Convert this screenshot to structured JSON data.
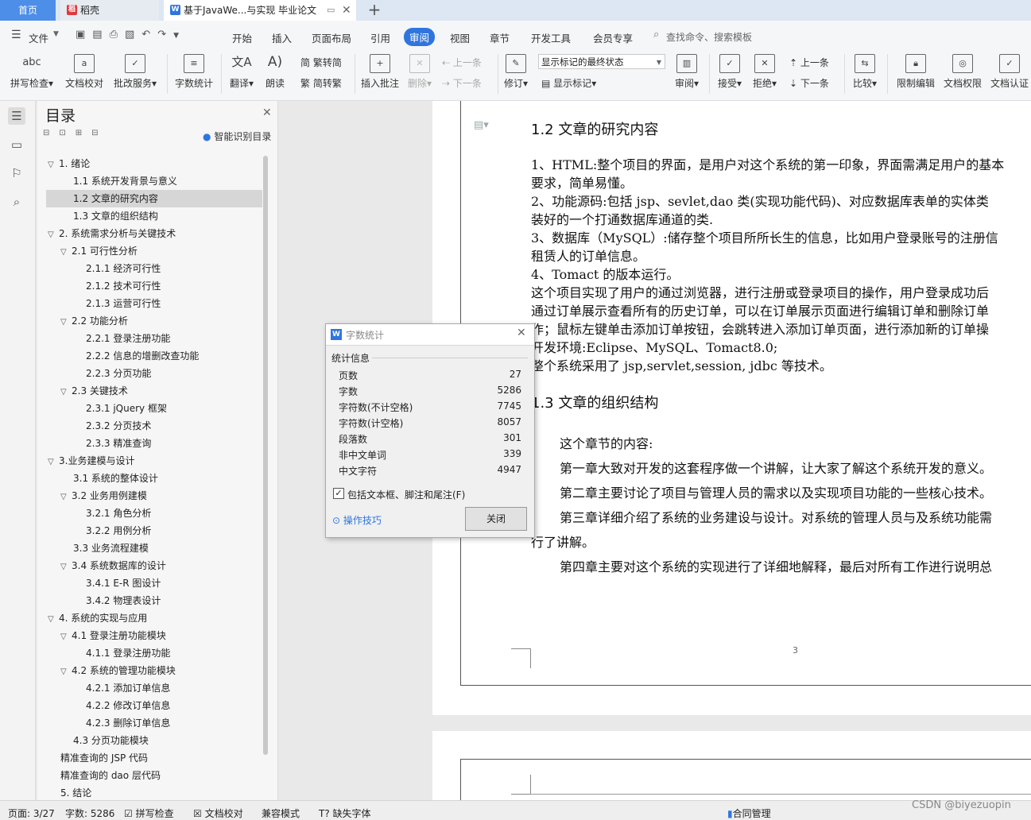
{
  "tabs": {
    "home": "首页",
    "daoke": "稻壳",
    "doc": "基于JavaWe...与实现 毕业论文"
  },
  "menu": {
    "file": "文件",
    "items": [
      "开始",
      "插入",
      "页面布局",
      "引用",
      "审阅",
      "视图",
      "章节",
      "开发工具",
      "会员专享"
    ],
    "search_placeholder": "查找命令、搜索模板"
  },
  "ribbon": {
    "spellcheck": "拼写检查",
    "proofread": "文档校对",
    "batch": "批改服务",
    "wordcount": "字数统计",
    "translate": "翻译",
    "read": "朗读",
    "trad": "繁转简",
    "simp": "简转繁",
    "insert_comment": "插入批注",
    "delete": "删除",
    "prev": "上一条",
    "next": "下一条",
    "revise": "修订",
    "combo_value": "显示标记的最终状态",
    "show_marks": "显示标记",
    "review": "审阅",
    "accept": "接受",
    "reject": "拒绝",
    "prev2": "上一条",
    "next2": "下一条",
    "compare": "比较",
    "restrict": "限制编辑",
    "perm": "文档权限",
    "auth": "文档认证"
  },
  "toc": {
    "title": "目录",
    "smart": "智能识别目录",
    "items": [
      {
        "text": "1. 绪论",
        "level": 0,
        "caret": true
      },
      {
        "text": "1.1  系统开发背景与意义",
        "level": 1,
        "caret": false
      },
      {
        "text": "1.2  文章的研究内容",
        "level": 1,
        "caret": false,
        "selected": true
      },
      {
        "text": "1.3  文章的组织结构",
        "level": 1,
        "caret": false
      },
      {
        "text": "2.  系统需求分析与关键技术",
        "level": 0,
        "caret": true
      },
      {
        "text": "2.1  可行性分析",
        "level": 1,
        "caret": true
      },
      {
        "text": "2.1.1  经济可行性",
        "level": 2,
        "caret": false
      },
      {
        "text": "2.1.2  技术可行性",
        "level": 2,
        "caret": false
      },
      {
        "text": "2.1.3  运营可行性",
        "level": 2,
        "caret": false
      },
      {
        "text": "2.2  功能分析",
        "level": 1,
        "caret": true
      },
      {
        "text": "2.2.1  登录注册功能",
        "level": 2,
        "caret": false
      },
      {
        "text": "2.2.2  信息的增删改查功能",
        "level": 2,
        "caret": false
      },
      {
        "text": "2.2.3  分页功能",
        "level": 2,
        "caret": false
      },
      {
        "text": "2.3  关键技术",
        "level": 1,
        "caret": true
      },
      {
        "text": "2.3.1  jQuery 框架",
        "level": 2,
        "caret": false
      },
      {
        "text": "2.3.2  分页技术",
        "level": 2,
        "caret": false
      },
      {
        "text": "2.3.3  精准查询",
        "level": 2,
        "caret": false
      },
      {
        "text": "3.业务建模与设计",
        "level": 0,
        "caret": true
      },
      {
        "text": "3.1  系统的整体设计",
        "level": 1,
        "caret": false
      },
      {
        "text": "3.2  业务用例建模",
        "level": 1,
        "caret": true
      },
      {
        "text": "3.2.1  角色分析",
        "level": 2,
        "caret": false
      },
      {
        "text": "3.2.2  用例分析",
        "level": 2,
        "caret": false
      },
      {
        "text": "3.3  业务流程建模",
        "level": 1,
        "caret": false
      },
      {
        "text": "3.4  系统数据库的设计",
        "level": 1,
        "caret": true
      },
      {
        "text": "3.4.1 E-R 图设计",
        "level": 2,
        "caret": false
      },
      {
        "text": "3.4.2  物理表设计",
        "level": 2,
        "caret": false
      },
      {
        "text": "4.  系统的实现与应用",
        "level": 0,
        "caret": true
      },
      {
        "text": "4.1 登录注册功能模块",
        "level": 1,
        "caret": true
      },
      {
        "text": "4.1.1 登录注册功能",
        "level": 2,
        "caret": false
      },
      {
        "text": "4.2 系统的管理功能模块",
        "level": 1,
        "caret": true
      },
      {
        "text": "4.2.1 添加订单信息",
        "level": 2,
        "caret": false
      },
      {
        "text": "4.2.2 修改订单信息",
        "level": 2,
        "caret": false
      },
      {
        "text": "4.2.3 删除订单信息",
        "level": 2,
        "caret": false
      },
      {
        "text": "4.3 分页功能模块",
        "level": 1,
        "caret": false
      },
      {
        "text": "精准查询的 JSP 代码",
        "level": 0,
        "caret": false
      },
      {
        "text": "精准查询的 dao 层代码",
        "level": 0,
        "caret": false
      },
      {
        "text": "5. 结论",
        "level": 0,
        "caret": false
      }
    ]
  },
  "document": {
    "h_12": "1.2 文章的研究内容",
    "p1a": "1、HTML:整个项目的界面，是用户对这个系统的第一印象，界面需满足用户的基本",
    "p1b": "要求，简单易懂。",
    "p2a": "2、功能源码:包括 jsp、sevlet,dao 类(实现功能代码)、对应数据库表单的实体类",
    "p2b": "装好的一个打通数据库通道的类.",
    "p3a": "3、数据库（MySQL）:储存整个项目所所长生的信息，比如用户登录账号的注册信",
    "p3b": "租赁人的订单信息。",
    "p4": "4、Tomact 的版本运行。",
    "p5a": "这个项目实现了用户的通过浏览器，进行注册或登录项目的操作，用户登录成功后",
    "p5b": "通过订单展示查看所有的历史订单，可以在订单展示页面进行编辑订单和删除订单",
    "p5c": "作；鼠标左键单击添加订单按钮，会跳转进入添加订单页面，进行添加新的订单操",
    "p6": "开发环境:Eclipse、MySQL、Tomact8.0;",
    "p7": "整个系统采用了 jsp,servlet,session, jdbc 等技术。",
    "h_13": "1.3 文章的组织结构",
    "q1": "这个章节的内容:",
    "q2": "第一章大致对开发的这套程序做一个讲解，让大家了解这个系统开发的意义。",
    "q3": "第二章主要讨论了项目与管理人员的需求以及实现项目功能的一些核心技术。",
    "q4a": "第三章详细介绍了系统的业务建设与设计。对系统的管理人员与及系统功能需",
    "q4b": "行了讲解。",
    "q5": "第四章主要对这个系统的实现进行了详细地解释，最后对所有工作进行说明总",
    "page_no": "3"
  },
  "dialog": {
    "title": "字数统计",
    "section": "统计信息",
    "rows": [
      {
        "label": "页数",
        "value": "27"
      },
      {
        "label": "字数",
        "value": "5286"
      },
      {
        "label": "字符数(不计空格)",
        "value": "7745"
      },
      {
        "label": "字符数(计空格)",
        "value": "8057"
      },
      {
        "label": "段落数",
        "value": "301"
      },
      {
        "label": "非中文单词",
        "value": "339"
      },
      {
        "label": "中文字符",
        "value": "4947"
      }
    ],
    "checkbox": "包括文本框、脚注和尾注(F)",
    "checked": true,
    "tips": "操作技巧",
    "close": "关闭"
  },
  "status": {
    "page": "页面: 3/27",
    "words": "字数: 5286",
    "spell": "拼写检查",
    "proof": "文档校对",
    "compat": "兼容模式",
    "font": "缺失字体",
    "contract": "合同管理",
    "watermark": "CSDN @biyezuopin"
  }
}
